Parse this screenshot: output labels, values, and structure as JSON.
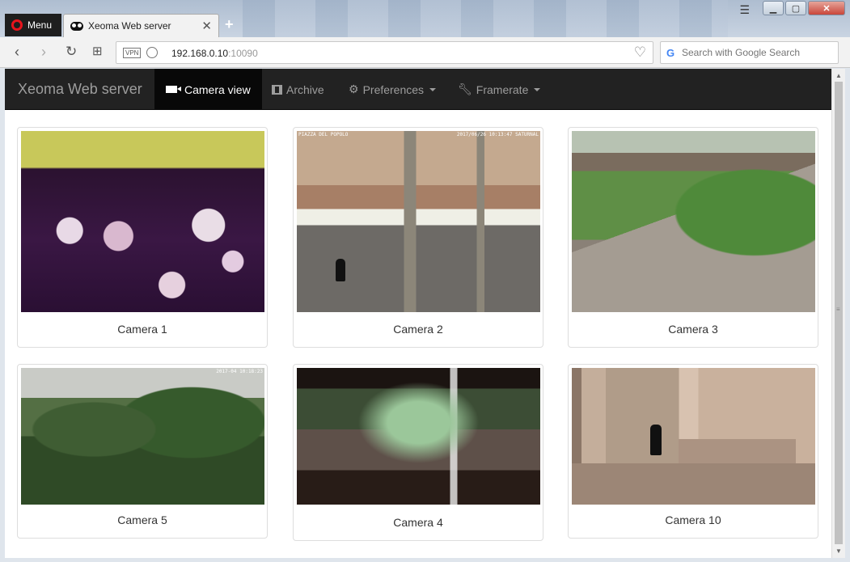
{
  "browser": {
    "menu_label": "Menu",
    "tab_title": "Xeoma Web server",
    "url_host": "192.168.0.10",
    "url_port": ":10090",
    "vpn_label": "VPN",
    "search_placeholder": "Search with Google Search",
    "search_logo": "G"
  },
  "app": {
    "brand": "Xeoma Web server",
    "nav": [
      {
        "label": "Camera view",
        "icon": "video-camera-icon",
        "active": true
      },
      {
        "label": "Archive",
        "icon": "film-icon",
        "active": false
      },
      {
        "label": "Preferences",
        "icon": "gear-icon",
        "active": false,
        "dropdown": true
      },
      {
        "label": "Framerate",
        "icon": "wrench-icon",
        "active": false,
        "dropdown": true
      }
    ]
  },
  "cameras": [
    {
      "label": "Camera 1"
    },
    {
      "label": "Camera 2",
      "overlay_left": "PIAZZA DEL POPOLO",
      "overlay_right": "2017/06/26 10:13:47 SATURNAL"
    },
    {
      "label": "Camera 3"
    },
    {
      "label": "Camera 5",
      "overlay_right": "2017-04 10:18:23"
    },
    {
      "label": "Camera 4"
    },
    {
      "label": "Camera 10"
    }
  ],
  "colors": {
    "navbar_bg": "#222222",
    "navbar_active": "#080808",
    "opera_red": "#e8141c"
  }
}
